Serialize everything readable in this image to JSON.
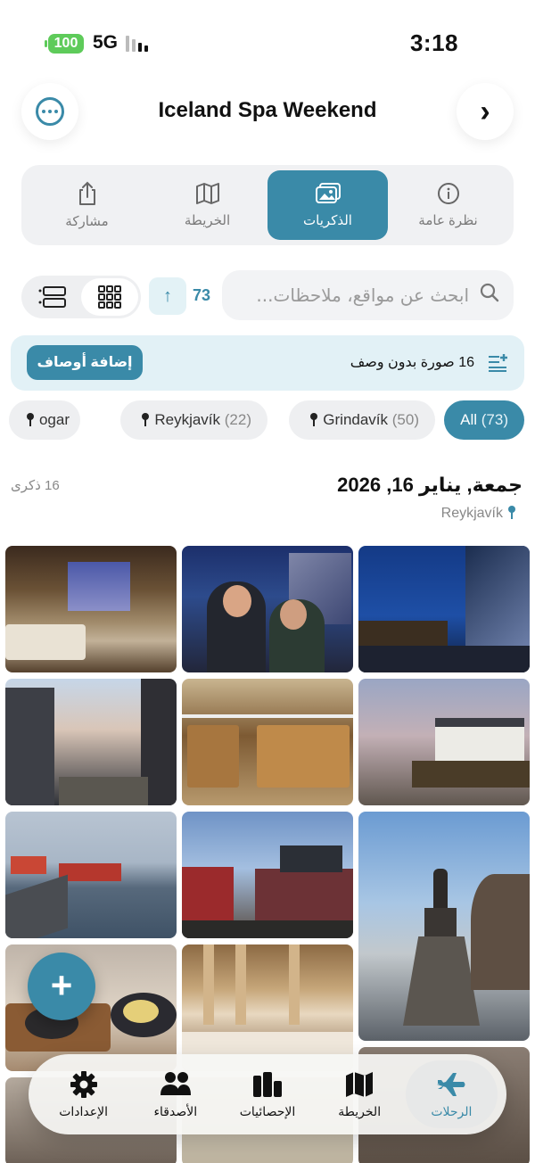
{
  "status": {
    "battery": "100",
    "network": "5G",
    "time": "3:18"
  },
  "header": {
    "title": "Iceland Spa Weekend"
  },
  "tabs": [
    {
      "label": "نظرة عامة",
      "icon": "info-icon"
    },
    {
      "label": "الذكريات",
      "icon": "photos-icon",
      "active": true
    },
    {
      "label": "الخريطة",
      "icon": "map-icon"
    },
    {
      "label": "مشاركة",
      "icon": "share-icon"
    }
  ],
  "search": {
    "placeholder": "ابحث عن مواقع، ملاحظات...",
    "count": "73"
  },
  "banner": {
    "text": "16 صورة بدون وصف",
    "button": "إضافة أوصاف"
  },
  "filters": [
    {
      "name": "All",
      "count": "(73)",
      "active": true
    },
    {
      "name": "Grindavík",
      "count": "(50)"
    },
    {
      "name": "Reykjavík",
      "count": "(22)"
    },
    {
      "name": "ogar",
      "count": ""
    }
  ],
  "section": {
    "date": "جمعة, يناير 16, 2026",
    "memories": "16 ذكرى",
    "location": "Reykjavík"
  },
  "photos": [
    {
      "name": "hotel-room"
    },
    {
      "name": "selfie-couple"
    },
    {
      "name": "harpa-night"
    },
    {
      "name": "street-dusk"
    },
    {
      "name": "bakery-window"
    },
    {
      "name": "white-house-statue"
    },
    {
      "name": "harbor-boats"
    },
    {
      "name": "colorful-buildings"
    },
    {
      "name": "statue-monument"
    },
    {
      "name": "restaurant-dish"
    },
    {
      "name": "restaurant-interior"
    }
  ],
  "fab": {
    "label": "+"
  },
  "bottom_nav": [
    {
      "label": "الرحلات",
      "icon": "plane-icon",
      "active": true
    },
    {
      "label": "الخريطة",
      "icon": "map-icon"
    },
    {
      "label": "الإحصائيات",
      "icon": "stats-icon"
    },
    {
      "label": "الأصدقاء",
      "icon": "friends-icon"
    },
    {
      "label": "الإعدادات",
      "icon": "gear-icon"
    }
  ],
  "colors": {
    "accent": "#3a8aa8",
    "chip_bg": "#eeeff1",
    "banner_bg": "#e2f1f6"
  }
}
